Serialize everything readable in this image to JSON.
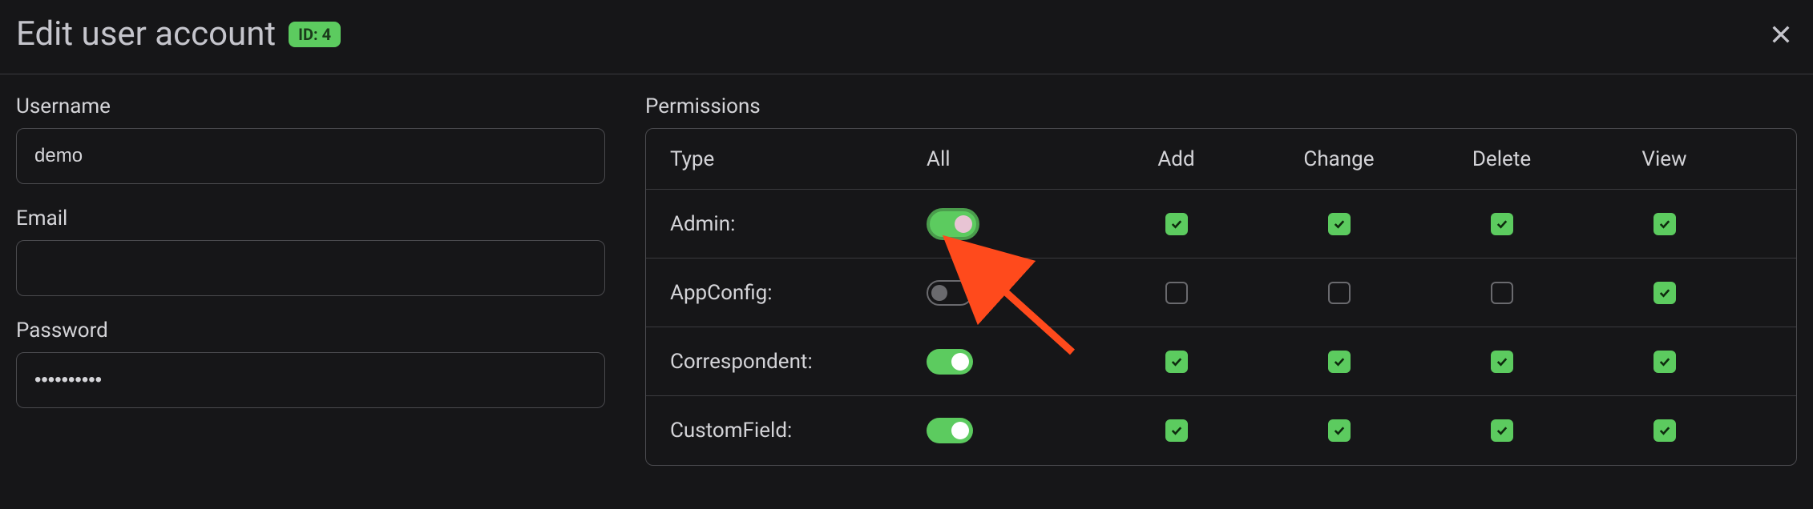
{
  "header": {
    "title": "Edit user account",
    "badge": "ID: 4"
  },
  "form": {
    "username": {
      "label": "Username",
      "value": "demo"
    },
    "email": {
      "label": "Email",
      "value": ""
    },
    "password": {
      "label": "Password",
      "value": "••••••••••"
    }
  },
  "permissions": {
    "label": "Permissions",
    "columns": {
      "type": "Type",
      "all": "All",
      "add": "Add",
      "change": "Change",
      "delete": "Delete",
      "view": "View"
    },
    "rows": [
      {
        "type": "Admin:",
        "all": true,
        "add": true,
        "change": true,
        "delete": true,
        "view": true,
        "highlight": true
      },
      {
        "type": "AppConfig:",
        "all": false,
        "add": false,
        "change": false,
        "delete": false,
        "view": true
      },
      {
        "type": "Correspondent:",
        "all": true,
        "add": true,
        "change": true,
        "delete": true,
        "view": true
      },
      {
        "type": "CustomField:",
        "all": true,
        "add": true,
        "change": true,
        "delete": true,
        "view": true
      }
    ]
  }
}
